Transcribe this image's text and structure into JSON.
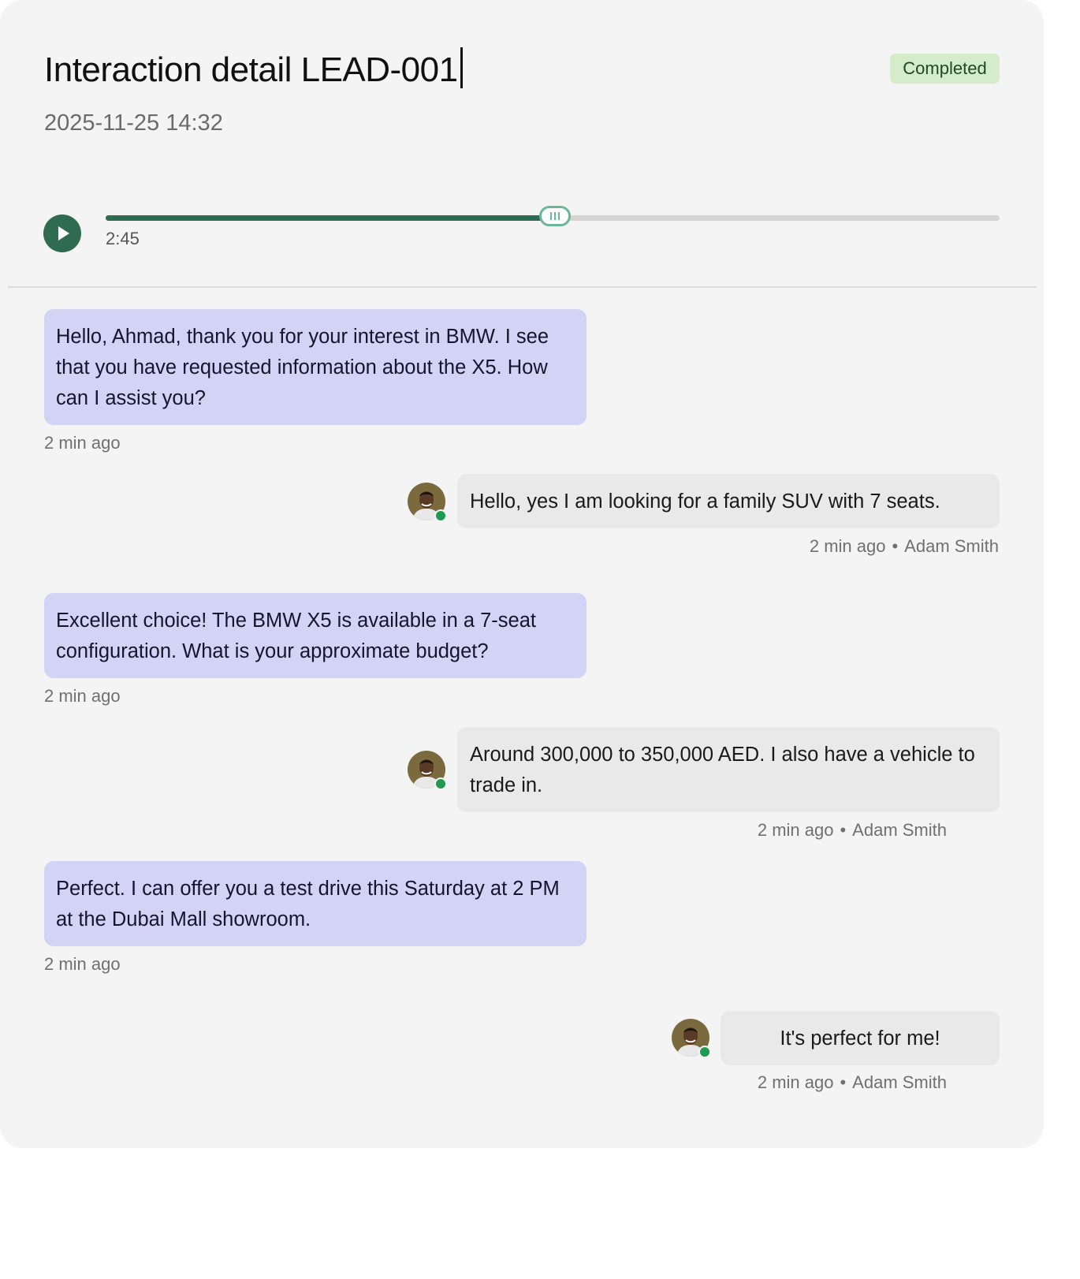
{
  "header": {
    "title": "Interaction detail LEAD-001",
    "date": "2025-11-25 14:32",
    "status": "Completed"
  },
  "player": {
    "time_label": "2:45",
    "progress": 0.503
  },
  "messages": [
    {
      "role": "agent",
      "text": "Hello, Ahmad, thank you for your interest in BMW. I see that you have requested information about the X5. How can I assist you?",
      "time": "2 min ago"
    },
    {
      "role": "user",
      "text": "Hello, yes I am looking for a family SUV with 7 seats.",
      "time": "2 min ago",
      "author": "Adam Smith"
    },
    {
      "role": "agent",
      "text": "Excellent choice! The BMW X5 is available in a 7-seat configuration. What is your approximate budget?",
      "time": "2 min ago"
    },
    {
      "role": "user",
      "text": "Around 300,000 to 350,000 AED. I also have a vehicle to trade in.",
      "time": "2 min ago",
      "author": "Adam Smith"
    },
    {
      "role": "agent",
      "text": "Perfect. I can offer you a test drive this Saturday at 2 PM at the Dubai Mall showroom.",
      "time": "2 min ago"
    },
    {
      "role": "user",
      "text": "It's perfect for me!",
      "time": "2 min ago",
      "author": "Adam Smith"
    }
  ],
  "meta_separator": "•",
  "colors": {
    "accent": "#2e6b50",
    "agent_bubble": "#d2d3f5",
    "user_bubble": "#e9e9e9",
    "badge_bg": "#d4ecc9",
    "online": "#1f9b4f"
  },
  "icons": {
    "play": "play-icon",
    "avatar": "user-avatar",
    "online": "online-status-dot"
  }
}
